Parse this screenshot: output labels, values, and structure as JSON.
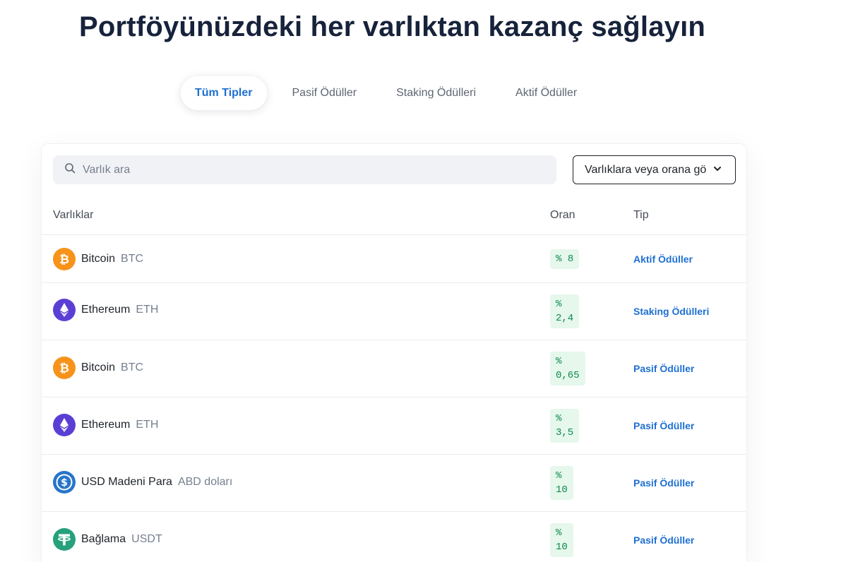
{
  "headline": "Portföyünüzdeki her varlıktan kazanç sağlayın",
  "tabs": [
    {
      "label": "Tüm Tipler"
    },
    {
      "label": "Pasif Ödüller"
    },
    {
      "label": "Staking Ödülleri"
    },
    {
      "label": "Aktif Ödüller"
    }
  ],
  "search": {
    "placeholder": "Varlık ara"
  },
  "sort": {
    "label": "Varlıklara veya orana gö"
  },
  "table": {
    "headers": {
      "asset": "Varlıklar",
      "rate": "Oran",
      "type": "Tip"
    },
    "rows": [
      {
        "name": "Bitcoin",
        "symbol": "BTC",
        "rate_pct": "%",
        "rate_val": "8",
        "type": "Aktif Ödüller",
        "icon": "bitcoin-icon"
      },
      {
        "name": "Ethereum",
        "symbol": "ETH",
        "rate_pct": "%",
        "rate_val": "2,4",
        "type": "Staking Ödülleri",
        "icon": "ethereum-icon"
      },
      {
        "name": "Bitcoin",
        "symbol": "BTC",
        "rate_pct": "%",
        "rate_val": "0,65",
        "type": "Pasif Ödüller",
        "icon": "bitcoin-icon"
      },
      {
        "name": "Ethereum",
        "symbol": "ETH",
        "rate_pct": "%",
        "rate_val": "3,5",
        "type": "Pasif Ödüller",
        "icon": "ethereum-icon"
      },
      {
        "name": "USD Madeni Para",
        "symbol": "ABD doları",
        "rate_pct": "%",
        "rate_val": "10",
        "type": "Pasif Ödüller",
        "icon": "usdc-icon"
      },
      {
        "name": "Bağlama",
        "symbol": "USDT",
        "rate_pct": "%",
        "rate_val": "10",
        "type": "Pasif Ödüller",
        "icon": "tether-icon"
      }
    ]
  },
  "colors": {
    "accent": "#1e6fd1",
    "heading": "#17223b",
    "rate_bg": "#e6f7ec",
    "rate_text": "#0b8a4a",
    "bitcoin": "#f7931a",
    "ethereum": "#5b3fd4",
    "usdc": "#2775ca",
    "tether": "#26a17b"
  }
}
